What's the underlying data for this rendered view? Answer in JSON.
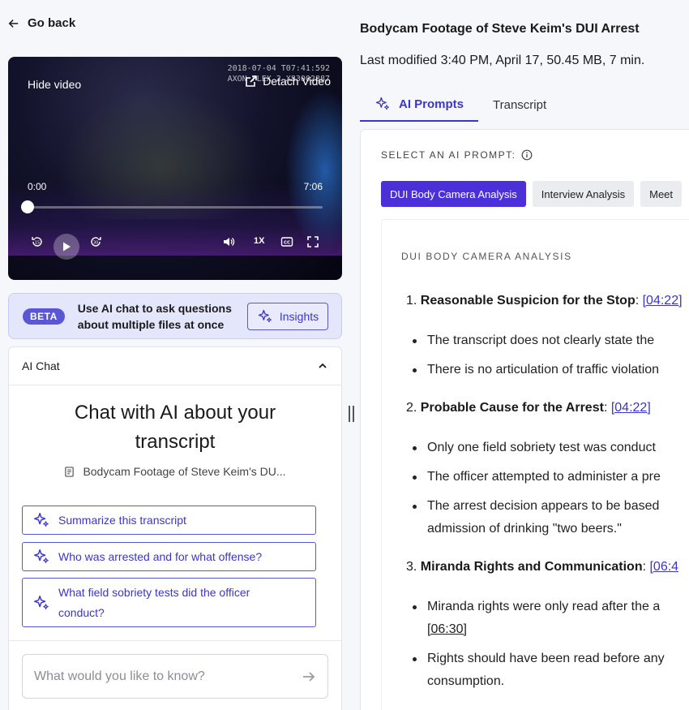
{
  "nav": {
    "go_back": "Go back"
  },
  "video": {
    "stamp_line1": "2018-07-04 T07:41:592",
    "stamp_line2": "AXON FLEX 2 X83002887",
    "hide_video": "Hide video",
    "detach": "Detach Video",
    "current_time": "0:00",
    "duration": "7:06",
    "progress": 0,
    "speed": "1X"
  },
  "beta": {
    "badge": "BETA",
    "text": "Use AI chat to ask questions about multiple files at once",
    "insights_label": "Insights"
  },
  "chat": {
    "header": "AI Chat",
    "title": "Chat with AI about your transcript",
    "file_name": "Bodycam Footage of Steve Keim's DU...",
    "suggestions": [
      "Summarize this transcript",
      "Who was arrested and for what offense?",
      "What field sobriety tests did the officer conduct?"
    ],
    "input_placeholder": "What would you like to know?"
  },
  "file": {
    "title": "Bodycam Footage of Steve Keim's DUI Arrest",
    "meta": "Last modified 3:40 PM, April 17, 50.45 MB, 7 min."
  },
  "tabs": [
    "AI Prompts",
    "Transcript"
  ],
  "prompts": {
    "label": "SELECT AN AI PROMPT:",
    "chips": [
      "DUI Body Camera Analysis",
      "Interview Analysis",
      "Meet"
    ]
  },
  "analysis": {
    "heading": "DUI BODY CAMERA ANALYSIS",
    "sections": [
      {
        "number": "1.",
        "title": "Reasonable Suspicion for the Stop",
        "timestamp": "[04:22]",
        "bullets": [
          "The transcript does not clearly state the",
          "There is no articulation of traffic violation"
        ]
      },
      {
        "number": "2.",
        "title": "Probable Cause for the Arrest",
        "timestamp": "[04:22]",
        "bullets": [
          "Only one field sobriety test was conduct",
          "The officer attempted to administer a pre",
          "The arrest decision appears to be based",
          "admission of drinking \"two beers.\""
        ]
      },
      {
        "number": "3.",
        "title": "Miranda Rights and Communication",
        "timestamp": "[06:4",
        "bullets": [
          "Miranda rights were only read after the a",
          "[06:30]",
          "Rights should have been read before any",
          "consumption."
        ]
      }
    ]
  },
  "colors": {
    "accent": "#3b36c9",
    "chip_active": "#4b2fd8",
    "beta_bg": "#e4e7fb"
  }
}
